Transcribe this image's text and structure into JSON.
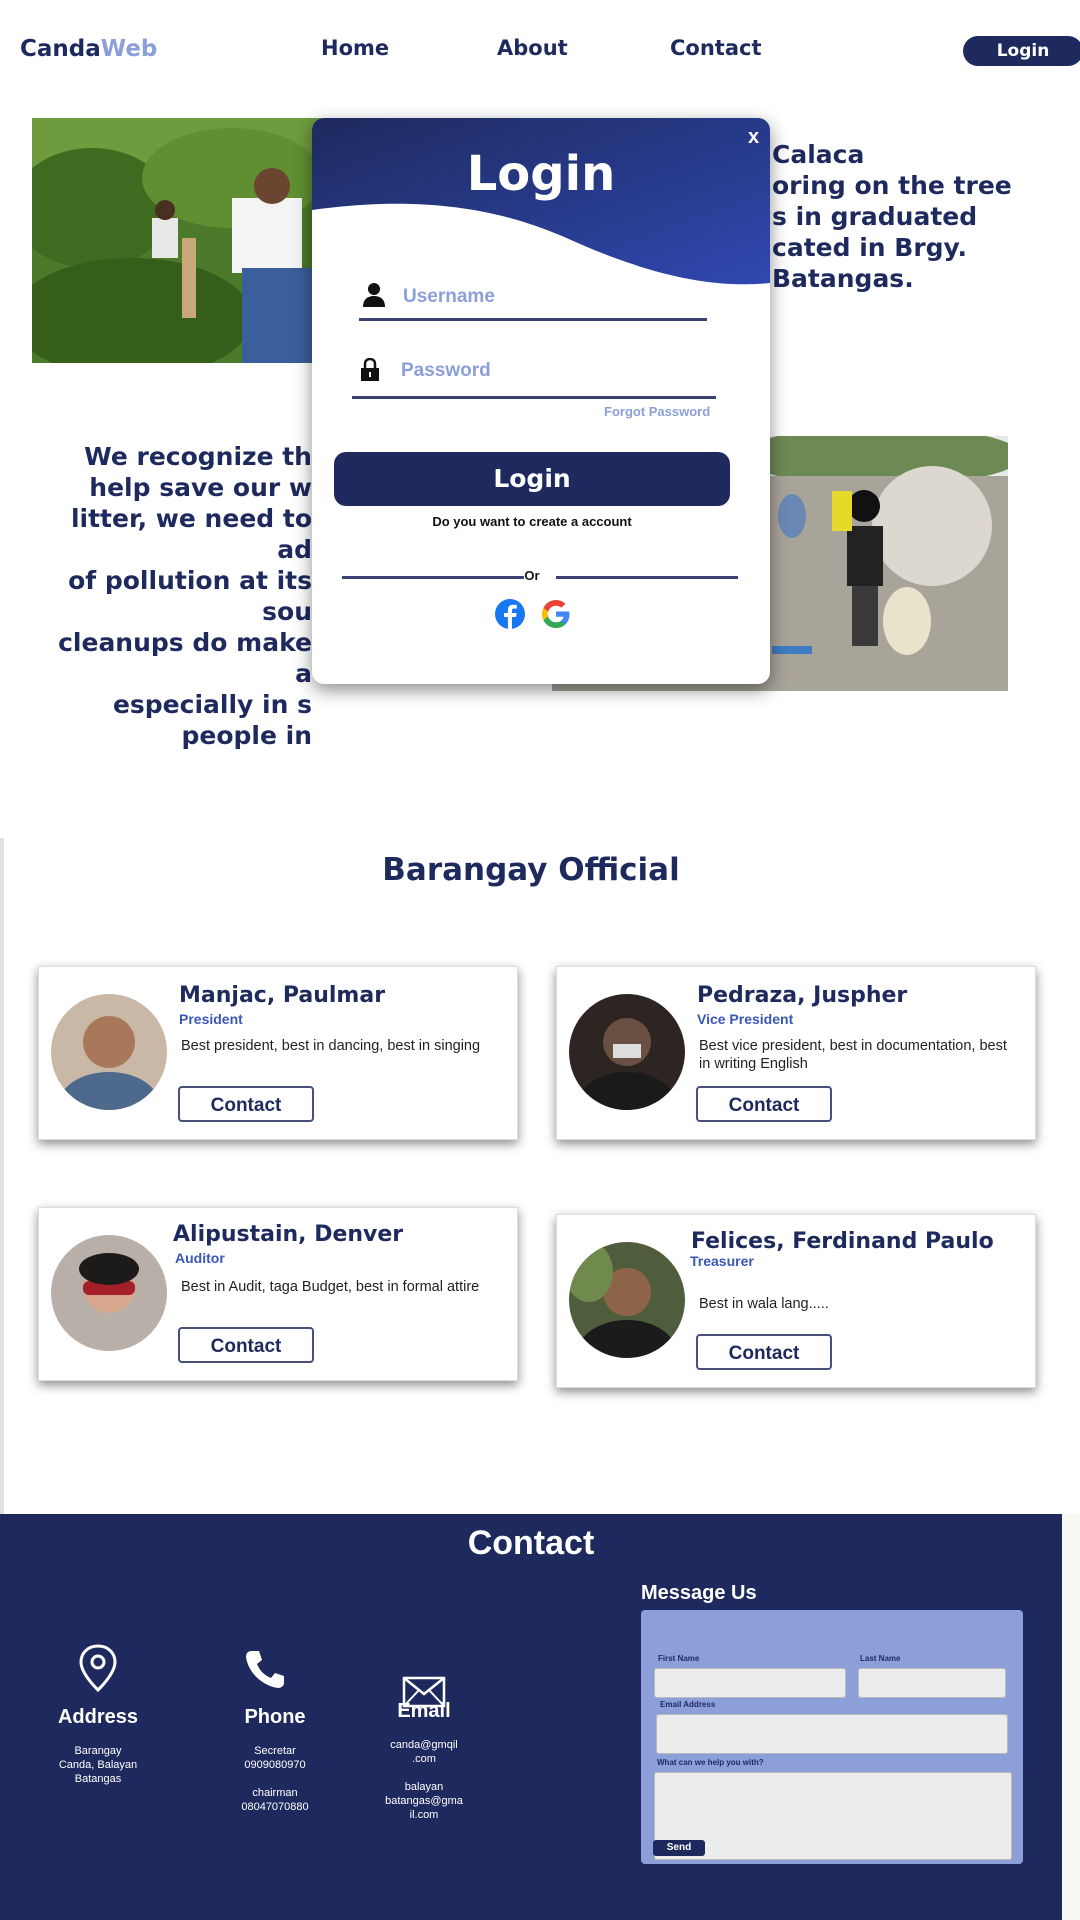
{
  "nav": {
    "brand_part1": "Canda",
    "brand_part2": "Web",
    "links": [
      "Home",
      "About",
      "Contact"
    ],
    "login_label": "Login"
  },
  "about": {
    "text1": "Calaca\noring on the tree\ns in graduated\ncated in Brgy.\nBatangas.",
    "text2_lines": [
      "We recognize th",
      "help save our w",
      "litter, we need to ad",
      "of pollution at its sou",
      "cleanups do make a",
      "especially in s",
      "people in"
    ]
  },
  "officials": {
    "title": "Barangay Official",
    "contact_label": "Contact",
    "cards": [
      {
        "name": "Manjac, Paulmar",
        "role": "President",
        "desc": "Best president, best in dancing, best in singing"
      },
      {
        "name": "Pedraza, Juspher",
        "role": "Vice President",
        "desc": "Best vice president, best in documentation, best in writing English"
      },
      {
        "name": "Alipustain, Denver",
        "role": "Auditor",
        "desc": "Best in Audit, taga Budget, best in formal attire"
      },
      {
        "name": "Felices, Ferdinand Paulo",
        "role": "Treasurer",
        "desc": "Best in wala lang....."
      }
    ]
  },
  "contact": {
    "title": "Contact",
    "address": {
      "title": "Address",
      "lines": [
        "Barangay",
        "Canda, Balayan",
        "Batangas"
      ]
    },
    "phone": {
      "title": "Phone",
      "lines": [
        "Secretar",
        "0909080970",
        "",
        "chairman",
        "08047070880"
      ]
    },
    "email": {
      "title": "Email",
      "lines": [
        "canda@gmqil",
        ".com",
        "",
        "balayan",
        "batangas@gma",
        "il.com"
      ]
    },
    "message": {
      "title": "Message Us",
      "first_name_label": "First Name",
      "last_name_label": "Last Name",
      "email_label": "Email Address",
      "help_label": "What can we help you with?",
      "send_label": "Send"
    }
  },
  "modal": {
    "close": "x",
    "title": "Login",
    "username_placeholder": "Username",
    "password_placeholder": "Password",
    "forgot": "Forgot Password",
    "login_button": "Login",
    "create_account": "Do you want to create a account",
    "or": "Or"
  },
  "colors": {
    "navy": "#1e2a5e",
    "accent": "#8b9fd8",
    "modal_header": "#2a3f9a"
  }
}
